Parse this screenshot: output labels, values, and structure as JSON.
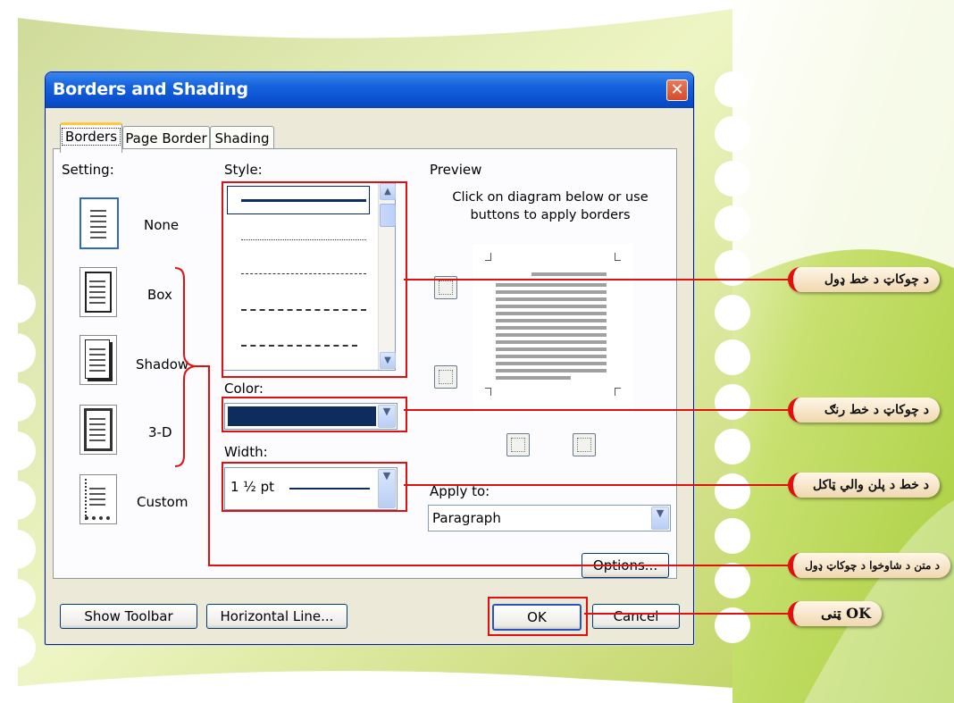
{
  "dialog": {
    "title": "Borders and Shading",
    "tabs": [
      "Borders",
      "Page Border",
      "Shading"
    ],
    "setting": {
      "label": "Setting:",
      "options": [
        "None",
        "Box",
        "Shadow",
        "3-D",
        "Custom"
      ]
    },
    "style": {
      "label": "Style:"
    },
    "color": {
      "label": "Color:",
      "value": "#0d2d5e"
    },
    "width": {
      "label": "Width:",
      "value": "1 ½ pt"
    },
    "preview": {
      "label": "Preview",
      "instruction_line1": "Click on diagram below or use",
      "instruction_line2": "buttons to apply borders"
    },
    "apply_to": {
      "label": "Apply to:",
      "value": "Paragraph"
    },
    "buttons": {
      "options": "Options...",
      "show_toolbar": "Show Toolbar",
      "horizontal_line": "Horizontal Line...",
      "ok": "OK",
      "cancel": "Cancel"
    }
  },
  "annotations": {
    "style": "د چوکاټ د خط ډول",
    "color": "د چوکاټ د خط رنګ",
    "width": "د خط د پلن والي ټاکل",
    "setting": "د متن د شاوخوا د چوکاټ ډول",
    "ok": "OK ټنی"
  },
  "colors": {
    "title_bar": "#0a4fcf",
    "highlight": "#e01010",
    "background_green": "#b9d66a"
  }
}
